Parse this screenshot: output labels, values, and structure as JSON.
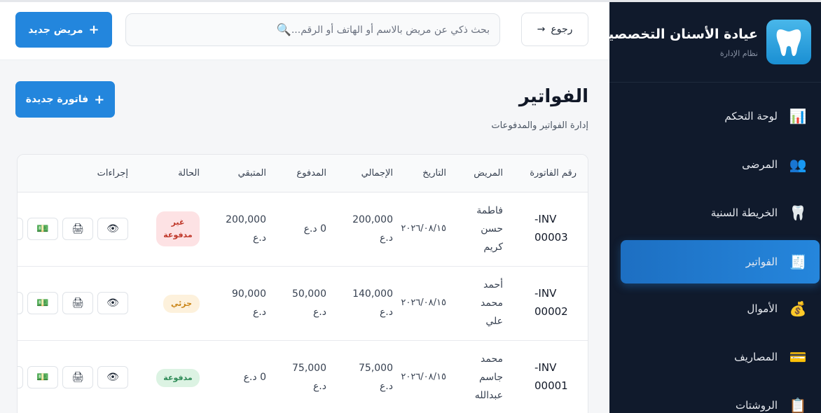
{
  "sidebar": {
    "title": "عيادة الأسنان التخصصية",
    "subtitle": "نظام الإدارة",
    "items": [
      {
        "label": "لوحة التحكم",
        "icon": "📊"
      },
      {
        "label": "المرضى",
        "icon": "👥"
      },
      {
        "label": "الخريطة السنية",
        "icon": "🦷"
      },
      {
        "label": "الفواتير",
        "icon": "🧾"
      },
      {
        "label": "الأموال",
        "icon": "💰"
      },
      {
        "label": "المصاريف",
        "icon": "💳"
      },
      {
        "label": "الروشتات",
        "icon": "📋"
      }
    ]
  },
  "topbar": {
    "back_label": "رجوع",
    "back_arrow": "→",
    "search_placeholder": "بحث ذكي عن مريض بالاسم أو الهاتف أو الرقم...",
    "new_patient_label": "مريض جديد"
  },
  "page": {
    "title": "الفواتير",
    "subtitle": "إدارة الفواتير والمدفوعات",
    "new_invoice_label": "فاتورة جديدة"
  },
  "table": {
    "headers": [
      "رقم الفاتورة",
      "المريض",
      "التاريخ",
      "الإجمالي",
      "المدفوع",
      "المتبقي",
      "الحالة",
      "إجراءات"
    ],
    "rows": [
      {
        "inv1": "INV-",
        "inv2": "00003",
        "p1": "فاطمة",
        "p2": "حسن",
        "p3": "كريم",
        "date": "٢٠٢٦/٠٨/١٥",
        "total1": "200,000",
        "total2": "د.ع",
        "paid1": "0 د.ع",
        "paid2": "",
        "rem1": "200,000",
        "rem2": "د.ع",
        "status": "غير مدفوعة",
        "status_bg": "#fde2e4",
        "status_fg": "#c0392b"
      },
      {
        "inv1": "INV-",
        "inv2": "00002",
        "p1": "أحمد",
        "p2": "محمد",
        "p3": "علي",
        "date": "٢٠٢٦/٠٨/١٥",
        "total1": "140,000",
        "total2": "د.ع",
        "paid1": "50,000",
        "paid2": "د.ع",
        "rem1": "90,000",
        "rem2": "د.ع",
        "status": "جزئي",
        "status_bg": "#fdf1dc",
        "status_fg": "#c98416"
      },
      {
        "inv1": "INV-",
        "inv2": "00001",
        "p1": "محمد",
        "p2": "جاسم",
        "p3": "عبدالله",
        "date": "٢٠٢٦/٠٨/١٥",
        "total1": "75,000",
        "total2": "د.ع",
        "paid1": "75,000",
        "paid2": "د.ع",
        "rem1": "0 د.ع",
        "rem2": "",
        "status": "مدفوعة",
        "status_bg": "#dcf3e3",
        "status_fg": "#2e8b57"
      }
    ],
    "actions": {
      "view": "👁",
      "print": "🖨",
      "pay": "💵"
    }
  }
}
